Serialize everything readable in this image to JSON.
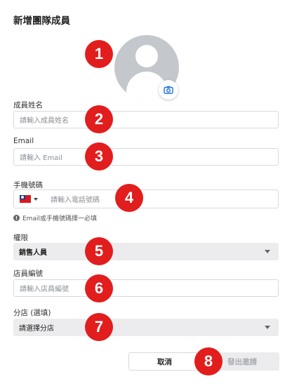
{
  "dialog": {
    "title": "新增團隊成員"
  },
  "avatar": {
    "icon": "avatar-placeholder-icon",
    "camera_icon": "camera-icon"
  },
  "fields": {
    "name": {
      "label": "成員姓名",
      "placeholder": "請輸入成員姓名"
    },
    "email": {
      "label": "Email",
      "placeholder": "請輸入 Email"
    },
    "phone": {
      "label": "手機號碼",
      "placeholder": "請輸入電話號碼",
      "country_flag": "taiwan-flag-icon"
    },
    "contact_hint": "Email或手機號碼擇一必填",
    "role": {
      "label": "權限",
      "value": "銷售人員"
    },
    "staff_id": {
      "label": "店員編號",
      "placeholder": "請輸入店員編號"
    },
    "branch": {
      "label": "分店 (選填)",
      "value": "請選擇分店"
    }
  },
  "buttons": {
    "cancel": "取消",
    "send": "發出邀請"
  },
  "markers": [
    "1",
    "2",
    "3",
    "4",
    "5",
    "6",
    "7",
    "8"
  ],
  "colors": {
    "marker": "#e21d1d",
    "avatar_bg": "#c4c7cc",
    "camera": "#1e74d6"
  }
}
